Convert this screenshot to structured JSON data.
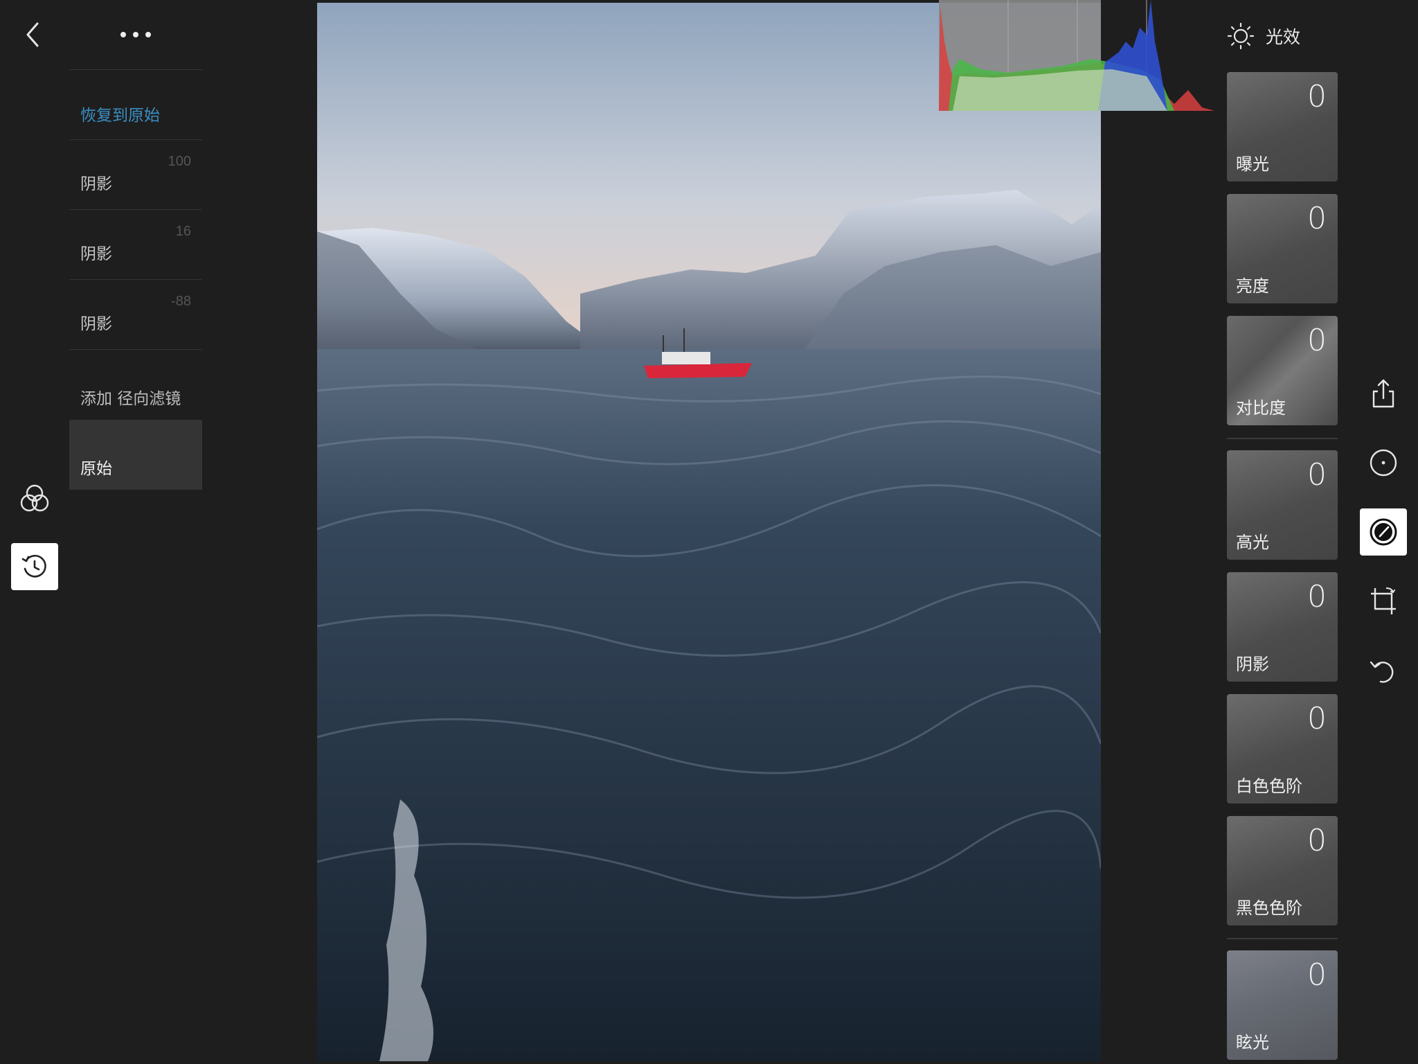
{
  "nav": {
    "back_icon": "chevron-left-icon",
    "more_icon": "more-dots-icon"
  },
  "history": {
    "restore_label": "恢复到原始",
    "items": [
      {
        "label": "阴影",
        "value": "100"
      },
      {
        "label": "阴影",
        "value": "16"
      },
      {
        "label": "阴影",
        "value": "-88"
      }
    ],
    "add_filter_label": "添加 径向滤镜",
    "original_label": "原始"
  },
  "left_tools": {
    "filters_icon": "overlapping-circles-icon",
    "history_icon": "history-clock-icon"
  },
  "panel": {
    "title_icon": "sun-icon",
    "title": "光效",
    "adjustments": [
      {
        "name": "曝光",
        "value": "0"
      },
      {
        "name": "亮度",
        "value": "0"
      },
      {
        "name": "对比度",
        "value": "0"
      },
      {
        "name": "高光",
        "value": "0"
      },
      {
        "name": "阴影",
        "value": "0"
      },
      {
        "name": "白色色阶",
        "value": "0"
      },
      {
        "name": "黑色色阶",
        "value": "0"
      },
      {
        "name": "眩光",
        "value": "0"
      }
    ]
  },
  "right_tools": [
    {
      "icon": "share-icon",
      "active": false
    },
    {
      "icon": "radial-dot-icon",
      "active": false
    },
    {
      "icon": "light-dial-icon",
      "active": true
    },
    {
      "icon": "crop-rotate-icon",
      "active": false
    },
    {
      "icon": "undo-icon",
      "active": false
    }
  ],
  "colors": {
    "accent": "#3a8fc4",
    "background": "#1e1e1e",
    "divider": "#343434"
  }
}
